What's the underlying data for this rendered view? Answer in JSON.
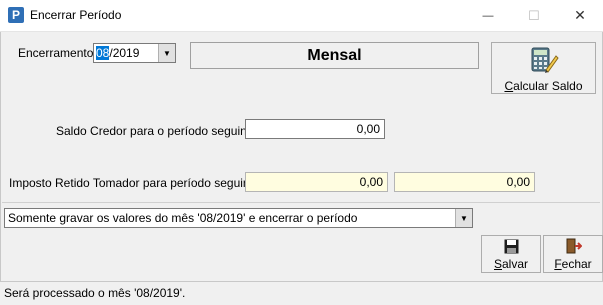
{
  "window": {
    "title": "Encerrar Período",
    "app_icon_letter": "P",
    "minimize_glyph": "—",
    "maximize_glyph": "☐",
    "close_glyph": "✕"
  },
  "encerramento": {
    "label": "Encerramento",
    "value_selected": "08",
    "value_rest": "/2019",
    "dropdown_glyph": "▼"
  },
  "period_type": "Mensal",
  "calcular_button": {
    "label_u": "C",
    "label_rest": "alcular Saldo",
    "icon": "calculator-pencil-icon"
  },
  "saldo_credor": {
    "label": "Saldo Credor para o período seguinte",
    "value": "0,00"
  },
  "imposto_retido": {
    "label": "Imposto Retido Tomador para período seguinte",
    "value1": "0,00",
    "value2": "0,00"
  },
  "action_select": {
    "value": "Somente gravar os valores do mês '08/2019' e encerrar o período",
    "dropdown_glyph": "▼"
  },
  "salvar_button": {
    "label_u": "S",
    "label_rest": "alvar",
    "icon": "floppy-disk-icon"
  },
  "fechar_button": {
    "label_u": "F",
    "label_rest": "echar",
    "icon": "exit-door-icon"
  },
  "status": {
    "text": "Será processado o mês '08/2019'."
  },
  "colors": {
    "yellow_field": "#fffde0",
    "title_icon": "#2f6fb6",
    "selection": "#0078d7"
  }
}
